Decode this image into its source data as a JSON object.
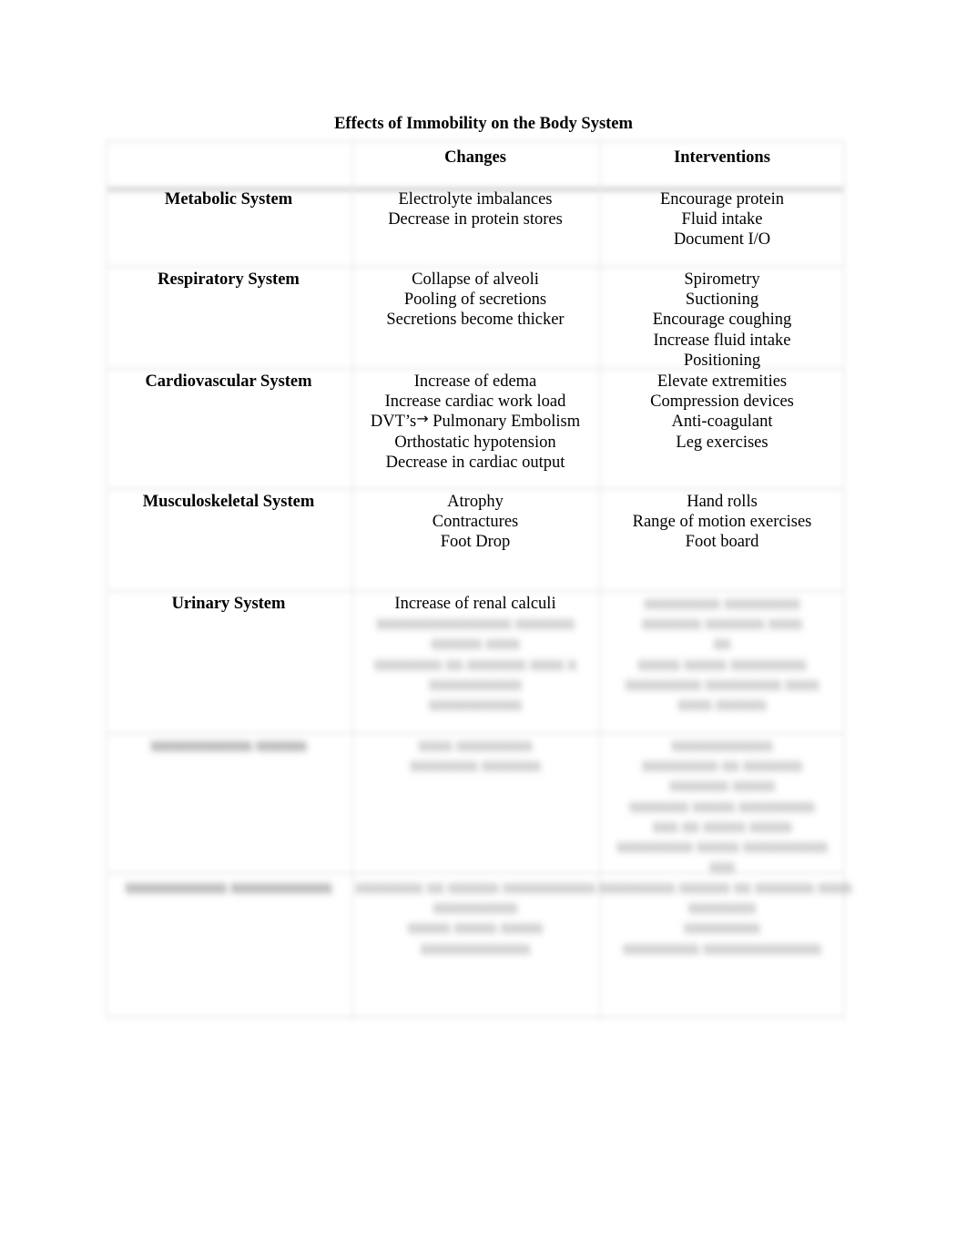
{
  "document": {
    "title": "Effects of Immobility on the Body System",
    "table": {
      "headers": [
        "",
        "Changes",
        "Interventions"
      ],
      "rows": [
        {
          "system": "Metabolic System",
          "changes": [
            "Electrolyte imbalances",
            "Decrease in protein stores"
          ],
          "interventions": [
            "Encourage protein",
            "Fluid intake",
            "Document I/O"
          ]
        },
        {
          "system": "Respiratory System",
          "changes": [
            "Collapse of alveoli",
            "Pooling of secretions",
            "Secretions become thicker"
          ],
          "interventions": [
            "Spirometry",
            "Suctioning",
            "Encourage coughing",
            "Increase fluid intake",
            "Positioning"
          ]
        },
        {
          "system": "Cardiovascular System",
          "changes": [
            "Increase of edema",
            "Increase cardiac work load",
            "DVT’s",
            "Pulmonary Embolism",
            "Orthostatic hypotension",
            "Decrease in cardiac output"
          ],
          "arrow_glyph": "→",
          "interventions": [
            "Elevate extremities",
            "Compression devices",
            "Anti-coagulant",
            "Leg exercises"
          ]
        },
        {
          "system": "Musculoskeletal System",
          "changes": [
            "Atrophy",
            "Contractures",
            "Foot Drop"
          ],
          "interventions": [
            "Hand rolls",
            "Range of motion exercises",
            "Foot board"
          ]
        },
        {
          "system": "Urinary System",
          "changes": [
            "Increase of renal calculi",
            "xxxxxxxxxxxxxxxx xxxxxxx",
            "xxxxxx xxxx",
            "xxxxxxxx xx xxxxxxx xxxx x",
            "xxxxxxxxxxx",
            "xxxxxxxxxxx"
          ],
          "interventions": [
            "xxxxxxxxx xxxxxxxxx",
            "xxxxxxx xxxxxxx xxxx",
            "xx",
            "xxxxx xxxxx xxxxxxxxx",
            "xxxxxxxxx xxxxxxxxx xxxx",
            "xxxx xxxxxx"
          ]
        },
        {
          "system": "xxxxxxxxxxxx xxxxxx",
          "changes": [
            "xxxx xxxxxxxxx",
            "xxxxxxxx xxxxxxx"
          ],
          "interventions": [
            "xxxxxxxxxxxx",
            "xxxxxxxxx xx xxxxxxx",
            "xxxxxxx xxxxx",
            "xxxxxxx xxxxx xxxxxxxxx",
            "xxx xx xxxxx xxxxx",
            "xxxxxxxxx xxxxx xxxxxxxxxx",
            "xxx"
          ]
        },
        {
          "system": "xxxxxxxxxxxx xxxxxxxxxxxx",
          "changes": [
            "xxxxxxxx xx xxxxxx xxxxxxxxxxx",
            "xxxxxxxxxx",
            "xxxxx xxxxx xxxxx",
            "xxxxxxxxxxxxx"
          ],
          "interventions": [
            "xxxxxxxxx xxxxxx xx xxxxxxx xxxx",
            "xxxxxxxx",
            "xxxxxxxxx",
            "xxxxxxxxx xxxxxxxxxxxxxx"
          ]
        }
      ],
      "blurred_from_row_index": 4
    }
  }
}
